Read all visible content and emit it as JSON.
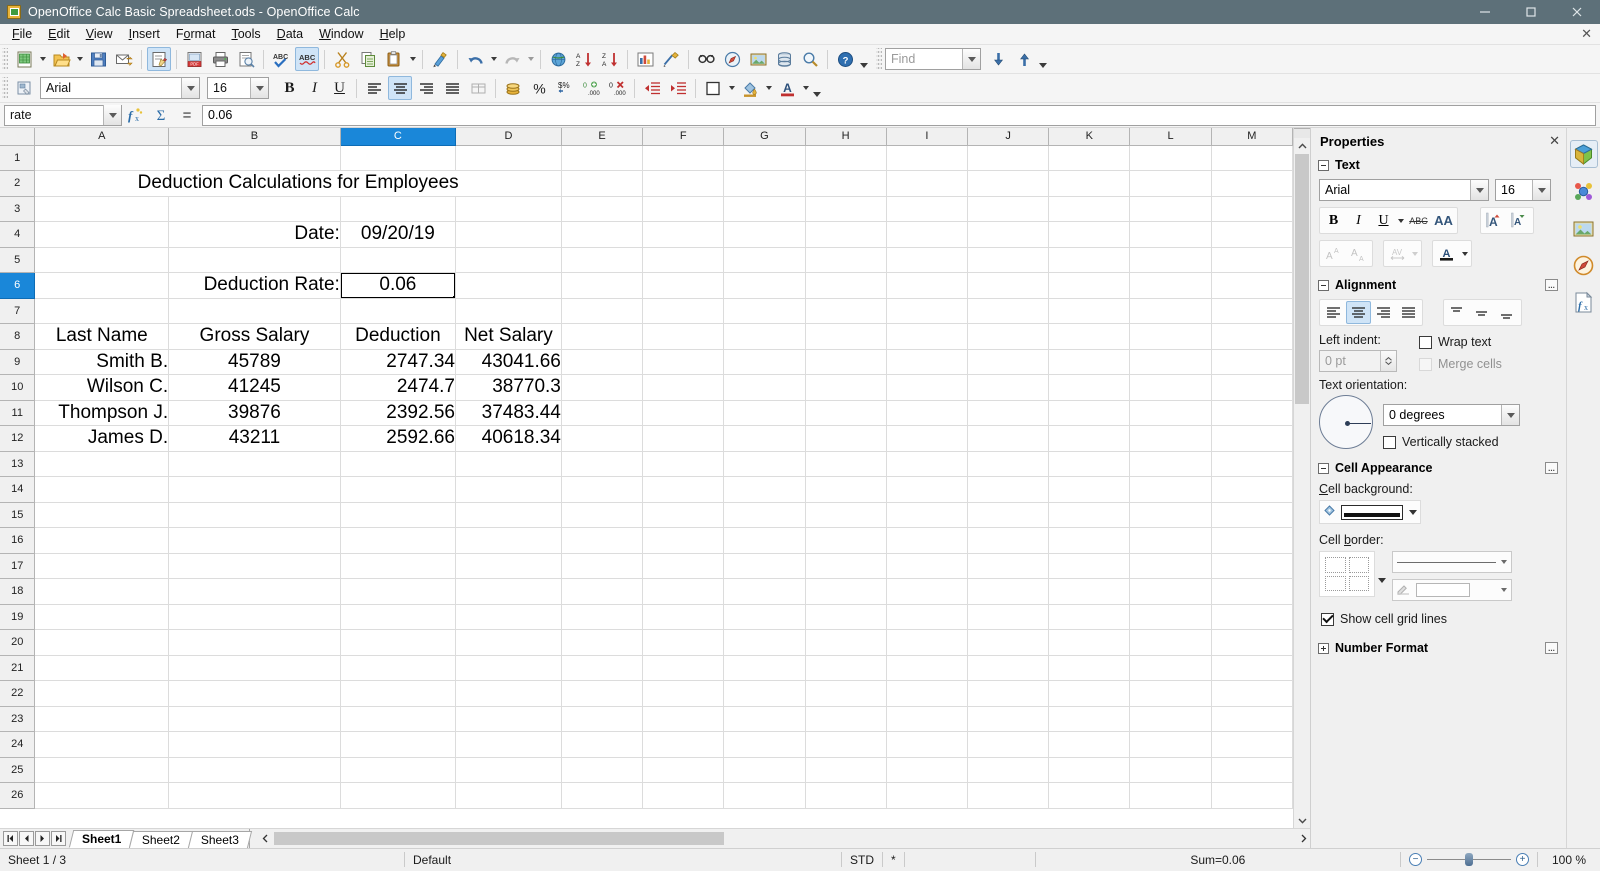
{
  "window": {
    "title": "OpenOffice Calc Basic Spreadsheet.ods - OpenOffice Calc",
    "minimize": "—",
    "restore": "❐",
    "close": "✕"
  },
  "menubar": {
    "items": [
      "File",
      "Edit",
      "View",
      "Insert",
      "Format",
      "Tools",
      "Data",
      "Window",
      "Help"
    ],
    "close_document": "✕"
  },
  "standard_toolbar": {
    "buttons": [
      "new-document",
      "open-document",
      "save-document",
      "email-document",
      "edit-file",
      "export-pdf",
      "print-file",
      "print-preview",
      "spelling",
      "autospellcheck",
      "cut",
      "copy",
      "paste",
      "clone-formatting",
      "undo",
      "redo",
      "hyperlink",
      "sort-ascending",
      "sort-descending",
      "insert-chart",
      "show-draw-functions",
      "find-and-replace",
      "navigator",
      "insert-image",
      "data-sources",
      "zoom",
      "help"
    ]
  },
  "find_toolbar": {
    "placeholder": "Find",
    "find_next": "find-next",
    "find_previous": "find-previous"
  },
  "format_toolbar": {
    "font_name": "Arial",
    "font_size": "16",
    "bold": "B",
    "italic": "I",
    "underline": "U"
  },
  "formula_bar": {
    "name_box": "rate",
    "function_wizard": "function-wizard",
    "sum": "sum",
    "equals": "=",
    "input_line": "0.06"
  },
  "sheet": {
    "columns": [
      "A",
      "B",
      "C",
      "D",
      "E",
      "F",
      "G",
      "H",
      "I",
      "J",
      "K",
      "L",
      "M"
    ],
    "selected_column": "C",
    "selected_row": "6",
    "selected_cell": "C6",
    "rows": [
      "1",
      "2",
      "3",
      "4",
      "5",
      "6",
      "7",
      "8",
      "9",
      "10",
      "11",
      "12",
      "13",
      "14",
      "15",
      "16",
      "17",
      "18",
      "19",
      "20",
      "21",
      "22",
      "23",
      "24",
      "25",
      "26"
    ],
    "cells": {
      "title": "Deduction Calculations for Employees",
      "date_label": "Date:",
      "date_value": "09/20/19",
      "rate_label": "Deduction Rate:",
      "rate_value": "0.06",
      "headers": [
        "Last Name",
        "Gross Salary",
        "Deduction",
        "Net Salary"
      ],
      "data": [
        [
          "Smith B.",
          "45789",
          "2747.34",
          "43041.66"
        ],
        [
          "Wilson C.",
          "41245",
          "2474.7",
          "38770.3"
        ],
        [
          "Thompson J.",
          "39876",
          "2392.56",
          "37483.44"
        ],
        [
          "James D.",
          "43211",
          "2592.66",
          "40618.34"
        ]
      ]
    },
    "tabs": [
      "Sheet1",
      "Sheet2",
      "Sheet3"
    ],
    "active_tab": "Sheet1"
  },
  "sidebar": {
    "title": "Properties",
    "close": "✕",
    "sections": {
      "text": {
        "label": "Text",
        "font_name": "Arial",
        "font_size": "16",
        "bold": "B",
        "italic": "I",
        "underline": "U",
        "strikethrough": "ABC",
        "shadow": "AA"
      },
      "alignment": {
        "label": "Alignment",
        "left_indent_label": "Left indent:",
        "left_indent_value": "0 pt",
        "wrap_text": "Wrap text",
        "merge_cells": "Merge cells",
        "text_orientation_label": "Text orientation:",
        "orientation_value": "0 degrees",
        "vertically_stacked": "Vertically stacked"
      },
      "cell_appearance": {
        "label": "Cell Appearance",
        "cell_background_label": "Cell background:",
        "cell_border_label": "Cell border:",
        "show_grid_lines": "Show cell grid lines"
      },
      "number_format": {
        "label": "Number Format"
      }
    },
    "rail": [
      "properties-icon",
      "styles-icon",
      "gallery-icon",
      "navigator-icon",
      "functions-icon"
    ]
  },
  "statusbar": {
    "sheet_position": "Sheet 1 / 3",
    "page_style": "Default",
    "selection_mode": "STD",
    "modified": "*",
    "sum": "Sum=0.06",
    "zoom_out": "−",
    "zoom_in": "+",
    "zoom_level": "100 %"
  },
  "colors": {
    "titlebar": "#5d7079",
    "selection_blue": "#1a87d9",
    "toolbar_bg": "#f5f5f5"
  }
}
